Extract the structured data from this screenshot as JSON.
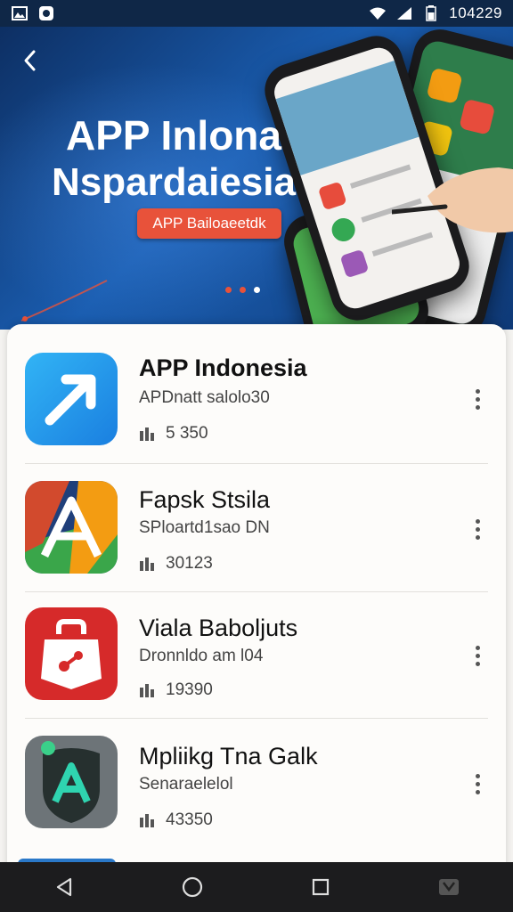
{
  "status_bar": {
    "time": "104229",
    "left_icons": [
      "gallery-icon",
      "app-notification-icon"
    ],
    "right_icons": [
      "wifi-icon",
      "signal-icon",
      "battery-icon"
    ]
  },
  "banner": {
    "title_line1": "APP Inlona",
    "title_line2": "Nspardaiesia",
    "button_label": "APP Bailoaeetdk",
    "page_dots": 3,
    "active_dot": 2,
    "colors": {
      "accent": "#e8523a",
      "background": "#1a5db0"
    }
  },
  "apps": [
    {
      "name": "APP Indonesia",
      "subtitle": "APDnatt salolo30",
      "stat": "5 350",
      "icon": "arrow-app-icon"
    },
    {
      "name": "Fapsk Stsila",
      "subtitle": "SPloartd1sao DN",
      "stat": "30123",
      "icon": "a-letter-app-icon"
    },
    {
      "name": "Viala Baboljuts",
      "subtitle": "Dronnldo am l04",
      "stat": "19390",
      "icon": "bag-app-icon"
    },
    {
      "name": "Mpliikg Tna Galk",
      "subtitle": "Senaraelelol",
      "stat": "43350",
      "icon": "shield-a-app-icon"
    }
  ],
  "nav_bar": {
    "buttons": [
      "back-triangle-icon",
      "home-circle-icon",
      "recents-square-icon",
      "assistant-icon"
    ]
  }
}
